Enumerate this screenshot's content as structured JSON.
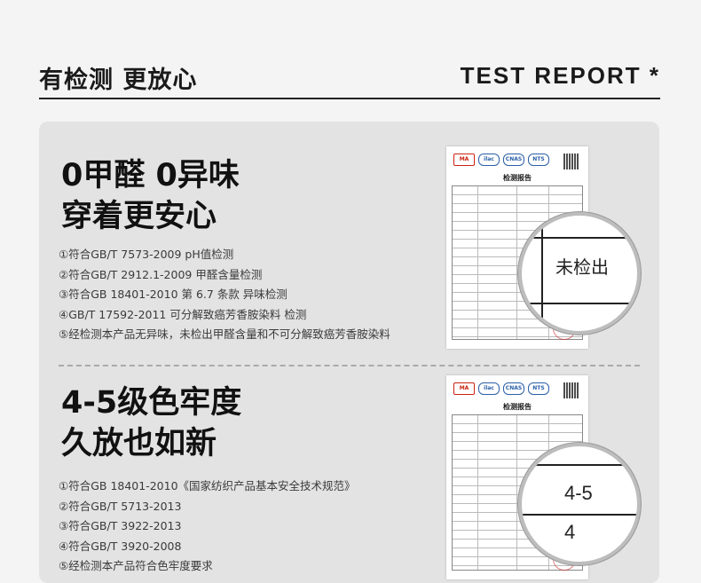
{
  "header": {
    "title_cn": "有检测 更放心",
    "title_en": "TEST REPORT *"
  },
  "sections": [
    {
      "headline": [
        "0甲醛 0异味",
        "穿着更安心"
      ],
      "items": [
        "①符合GB/T 7573-2009 pH值检测",
        "②符合GB/T 2912.1-2009 甲醛含量检测",
        "③符合GB 18401-2010 第 6.7 条款 异味检测",
        "④GB/T 17592-2011 可分解致癌芳香胺染料 检测",
        "⑤经检测本产品无异味，未检出甲醛含量和不可分解致癌芳香胺染料"
      ],
      "report": {
        "title": "检测报告",
        "logos": [
          "MA",
          "ilac",
          "CNAS",
          "NTS"
        ],
        "magnified": [
          "未检出"
        ]
      }
    },
    {
      "headline": [
        "4-5级色牢度",
        "久放也如新"
      ],
      "items": [
        "①符合GB 18401-2010《国家纺织产品基本安全技术规范》",
        "②符合GB/T 5713-2013",
        "③符合GB/T 3922-2013",
        "④符合GB/T 3920-2008",
        "⑤经检测本产品符合色牢度要求"
      ],
      "report": {
        "title": "检测报告",
        "logos": [
          "MA",
          "ilac",
          "CNAS",
          "NTS"
        ],
        "magnified": [
          "4-5",
          "4"
        ]
      }
    }
  ]
}
